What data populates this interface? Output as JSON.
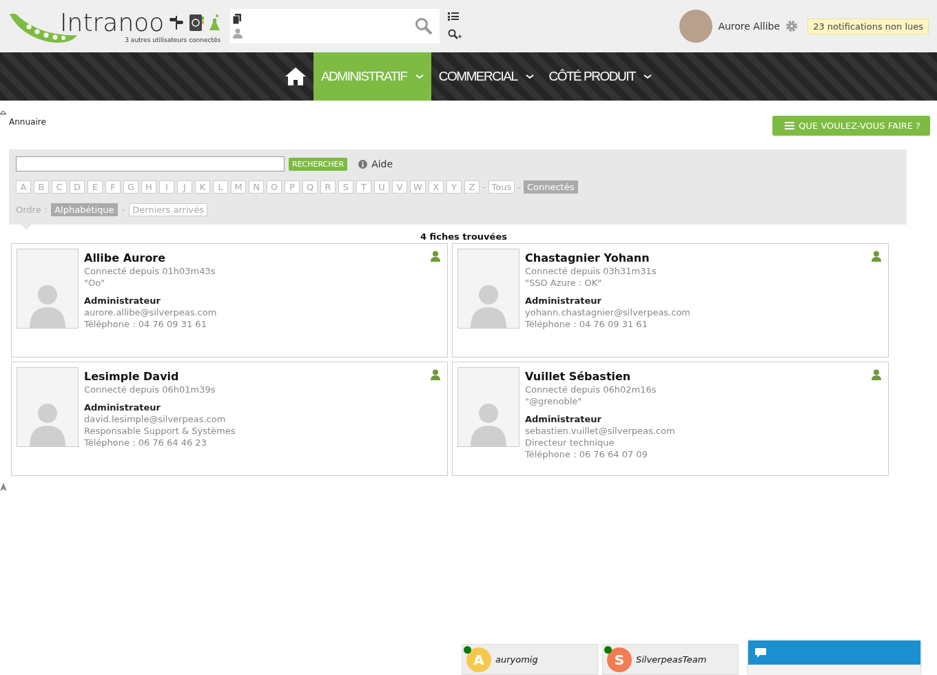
{
  "header": {
    "logo": "Intranoo",
    "connected_users": "3 autres utilisateurs connectés",
    "user_name": "Aurore Allibe",
    "notifications": "23 notifications non lues"
  },
  "nav": [
    {
      "kind": "home",
      "selected": false
    },
    {
      "label": "ADMINISTRATIF",
      "selected": true
    },
    {
      "label": "COMMERCIAL",
      "selected": false
    },
    {
      "label": "CÔTÉ PRODUIT",
      "selected": false
    }
  ],
  "breadcrumb": "Annuaire",
  "action_button": "QUE VOULEZ-VOUS FAIRE ?",
  "search": {
    "button": "RECHERCHER",
    "help": "Aide"
  },
  "letters": [
    {
      "kind": "letter",
      "label": "A",
      "selected": false
    },
    {
      "kind": "letter",
      "label": "B",
      "selected": false
    },
    {
      "kind": "letter",
      "label": "C",
      "selected": false
    },
    {
      "kind": "letter",
      "label": "D",
      "selected": false
    },
    {
      "kind": "letter",
      "label": "E",
      "selected": false
    },
    {
      "kind": "letter",
      "label": "F",
      "selected": false
    },
    {
      "kind": "letter",
      "label": "G",
      "selected": false
    },
    {
      "kind": "letter",
      "label": "H",
      "selected": false
    },
    {
      "kind": "letter",
      "label": "I",
      "selected": false
    },
    {
      "kind": "letter",
      "label": "J",
      "selected": false
    },
    {
      "kind": "letter",
      "label": "K",
      "selected": false
    },
    {
      "kind": "letter",
      "label": "L",
      "selected": false
    },
    {
      "kind": "letter",
      "label": "M",
      "selected": false
    },
    {
      "kind": "letter",
      "label": "N",
      "selected": false
    },
    {
      "kind": "letter",
      "label": "O",
      "selected": false
    },
    {
      "kind": "letter",
      "label": "P",
      "selected": false
    },
    {
      "kind": "letter",
      "label": "Q",
      "selected": false
    },
    {
      "kind": "letter",
      "label": "R",
      "selected": false
    },
    {
      "kind": "letter",
      "label": "S",
      "selected": false
    },
    {
      "kind": "letter",
      "label": "T",
      "selected": false
    },
    {
      "kind": "letter",
      "label": "U",
      "selected": false
    },
    {
      "kind": "letter",
      "label": "V",
      "selected": false
    },
    {
      "kind": "letter",
      "label": "W",
      "selected": false
    },
    {
      "kind": "letter",
      "label": "X",
      "selected": false
    },
    {
      "kind": "letter",
      "label": "Y",
      "selected": false
    },
    {
      "kind": "letter",
      "label": "Z",
      "selected": false
    },
    {
      "kind": "separator",
      "label": "-"
    },
    {
      "kind": "letter",
      "label": "Tous",
      "selected": false
    },
    {
      "kind": "separator",
      "label": "-"
    },
    {
      "kind": "letter",
      "label": "Connectés",
      "selected": true
    }
  ],
  "order": {
    "label": "Ordre :",
    "options": [
      {
        "kind": "option",
        "label": "Alphabétique",
        "selected": true
      },
      {
        "kind": "separator",
        "label": "-"
      },
      {
        "kind": "option",
        "label": "Derniers arrivés",
        "selected": false
      }
    ]
  },
  "result_count": "4 fiches trouvées",
  "cards": [
    {
      "name": "Allibe Aurore",
      "connected": "Connecté depuis 01h03m43s",
      "status": "\"Oo\"",
      "role": "Administrateur",
      "email": "aurore.allibe@silverpeas.com",
      "phone": "Téléphone : 04 76 09 31 61"
    },
    {
      "name": "Chastagnier Yohann",
      "connected": "Connecté depuis 03h31m31s",
      "status": "\"SSO Azure : OK\"",
      "role": "Administrateur",
      "email": "yohann.chastagnier@silverpeas.com",
      "phone": "Téléphone : 04 76 09 31 61"
    },
    {
      "name": "Lesimple David",
      "connected": "Connecté depuis 06h01m39s",
      "role": "Administrateur",
      "email": "david.lesimple@silverpeas.com",
      "position": "Responsable Support & Systèmes",
      "phone": "Téléphone : 06 76 64 46 23"
    },
    {
      "name": "Vuillet Sébastien",
      "connected": "Connecté depuis 06h02m16s",
      "status": "\"@grenoble\"",
      "role": "Administrateur",
      "email": "sebastien.vuillet@silverpeas.com",
      "position": "Directeur technique",
      "phone": "Téléphone : 06 76 64 07 09"
    }
  ],
  "chat_contacts": [
    {
      "initial": "A",
      "name": "auryomig",
      "color": "#f5c94f",
      "online": true
    },
    {
      "initial": "S",
      "name": "SilverpeasTeam",
      "color": "#f27d52",
      "online": true
    }
  ]
}
